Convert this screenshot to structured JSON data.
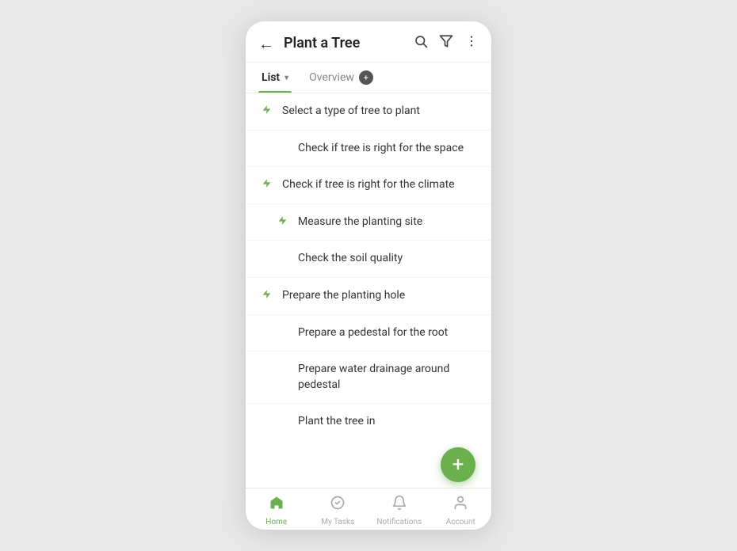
{
  "header": {
    "title": "Plant a Tree",
    "back_label": "←",
    "search_label": "⌕",
    "filter_label": "⋁",
    "more_label": "⋮"
  },
  "tabs": [
    {
      "id": "list",
      "label": "List",
      "active": true,
      "has_dropdown": true
    },
    {
      "id": "overview",
      "label": "Overview",
      "active": false,
      "has_dropdown": false,
      "badge": "+"
    }
  ],
  "tasks": [
    {
      "id": 1,
      "text": "Select a type of tree to plant",
      "indent": 0,
      "has_icon": true,
      "icon": "⚡"
    },
    {
      "id": 2,
      "text": "Check if tree is right for the space",
      "indent": 1,
      "has_icon": false
    },
    {
      "id": 3,
      "text": "Check if tree is right for the climate",
      "indent": 0,
      "has_icon": true,
      "icon": "⚡"
    },
    {
      "id": 4,
      "text": "Measure the planting site",
      "indent": 1,
      "has_icon": true,
      "icon": "⚡"
    },
    {
      "id": 5,
      "text": "Check the soil quality",
      "indent": 1,
      "has_icon": false
    },
    {
      "id": 6,
      "text": "Prepare the planting hole",
      "indent": 0,
      "has_icon": true,
      "icon": "⚡"
    },
    {
      "id": 7,
      "text": "Prepare a pedestal for the root",
      "indent": 1,
      "has_icon": false
    },
    {
      "id": 8,
      "text": "Prepare water drainage around pedestal",
      "indent": 1,
      "has_icon": false
    },
    {
      "id": 9,
      "text": "Plant the tree in",
      "indent": 1,
      "has_icon": false
    }
  ],
  "fab": {
    "label": "+"
  },
  "bottom_nav": [
    {
      "id": "home",
      "label": "Home",
      "active": true,
      "icon": "home"
    },
    {
      "id": "my-tasks",
      "label": "My Tasks",
      "active": false,
      "icon": "check-circle"
    },
    {
      "id": "notifications",
      "label": "Notifications",
      "active": false,
      "icon": "bell"
    },
    {
      "id": "account",
      "label": "Account",
      "active": false,
      "icon": "user"
    }
  ]
}
